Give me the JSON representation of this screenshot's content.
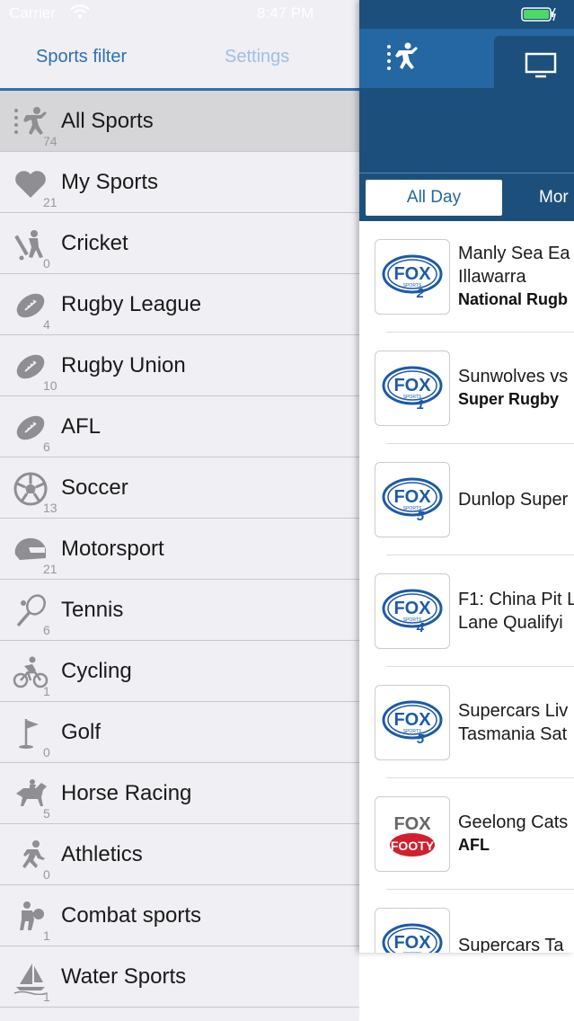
{
  "status_bar": {
    "carrier": "Carrier",
    "time": "8:47 PM"
  },
  "drawer": {
    "tabs": {
      "sports_filter": "Sports filter",
      "settings": "Settings"
    },
    "sports": [
      {
        "name": "All Sports",
        "count": "74",
        "icon": "all-sports-icon",
        "selected": true
      },
      {
        "name": "My Sports",
        "count": "21",
        "icon": "heart-icon"
      },
      {
        "name": "Cricket",
        "count": "0",
        "icon": "cricket-icon"
      },
      {
        "name": "Rugby League",
        "count": "4",
        "icon": "rugby-ball-icon"
      },
      {
        "name": "Rugby Union",
        "count": "10",
        "icon": "rugby-ball-icon"
      },
      {
        "name": "AFL",
        "count": "6",
        "icon": "rugby-ball-icon"
      },
      {
        "name": "Soccer",
        "count": "13",
        "icon": "soccer-ball-icon"
      },
      {
        "name": "Motorsport",
        "count": "21",
        "icon": "helmet-icon"
      },
      {
        "name": "Tennis",
        "count": "6",
        "icon": "tennis-racket-icon"
      },
      {
        "name": "Cycling",
        "count": "1",
        "icon": "cyclist-icon"
      },
      {
        "name": "Golf",
        "count": "0",
        "icon": "golf-flag-icon"
      },
      {
        "name": "Horse Racing",
        "count": "5",
        "icon": "horse-racing-icon"
      },
      {
        "name": "Athletics",
        "count": "0",
        "icon": "runner-icon"
      },
      {
        "name": "Combat sports",
        "count": "1",
        "icon": "boxing-icon"
      },
      {
        "name": "Water Sports",
        "count": "1",
        "icon": "sailing-icon"
      }
    ]
  },
  "main": {
    "filters": {
      "all_day": "All Day",
      "more": "Mor"
    },
    "listings": [
      {
        "channel": "FOX SPORTS 2",
        "channel_num": "2",
        "title_lines": [
          "Manly Sea Ea",
          "Illawarra"
        ],
        "competition": "National Rugb"
      },
      {
        "channel": "FOX SPORTS 1",
        "channel_num": "1",
        "title_lines": [
          "Sunwolves vs"
        ],
        "competition": "Super Rugby"
      },
      {
        "channel": "FOX SPORTS 5",
        "channel_num": "5",
        "title_lines": [
          "Dunlop Super"
        ],
        "competition": ""
      },
      {
        "channel": "FOX SPORTS 4",
        "channel_num": "4",
        "title_lines": [
          "F1: China Pit L",
          "Lane Qualifyi"
        ],
        "competition": ""
      },
      {
        "channel": "FOX SPORTS 5",
        "channel_num": "5",
        "title_lines": [
          "Supercars Liv",
          "Tasmania Sat"
        ],
        "competition": ""
      },
      {
        "channel": "FOX FOOTY",
        "channel_num": "",
        "title_lines": [
          "Geelong Cats"
        ],
        "competition": "AFL"
      },
      {
        "channel": "FOX SPORTS",
        "channel_num": "",
        "title_lines": [
          "Supercars Ta"
        ],
        "competition": ""
      }
    ]
  },
  "colors": {
    "accent": "#2f6fb0",
    "header_dark": "#1d4f7c",
    "header_mid": "#2467a2",
    "fox_blue": "#1c5aa8",
    "footy_red": "#d0202e"
  }
}
